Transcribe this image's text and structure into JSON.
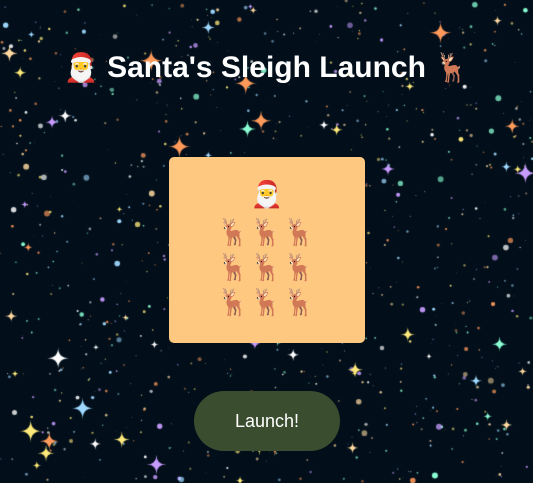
{
  "title": {
    "santa_emoji": "🎅",
    "text": "Santa's Sleigh Launch",
    "reindeer_emoji": "🦌"
  },
  "sleigh": {
    "santa": "🎅",
    "reindeer": [
      "🦌",
      "🦌",
      "🦌",
      "🦌",
      "🦌",
      "🦌",
      "🦌",
      "🦌",
      "🦌"
    ],
    "background_color": "#ffc880"
  },
  "launch_button": {
    "label": "Launch!",
    "color": "#3a4d2e"
  },
  "theme": {
    "background": "#020f1a",
    "star_colors": [
      "#ffffff",
      "#ffd9a0",
      "#ff9a5a",
      "#9fd8ff",
      "#c79bff",
      "#8affd4",
      "#ffe97a"
    ]
  }
}
